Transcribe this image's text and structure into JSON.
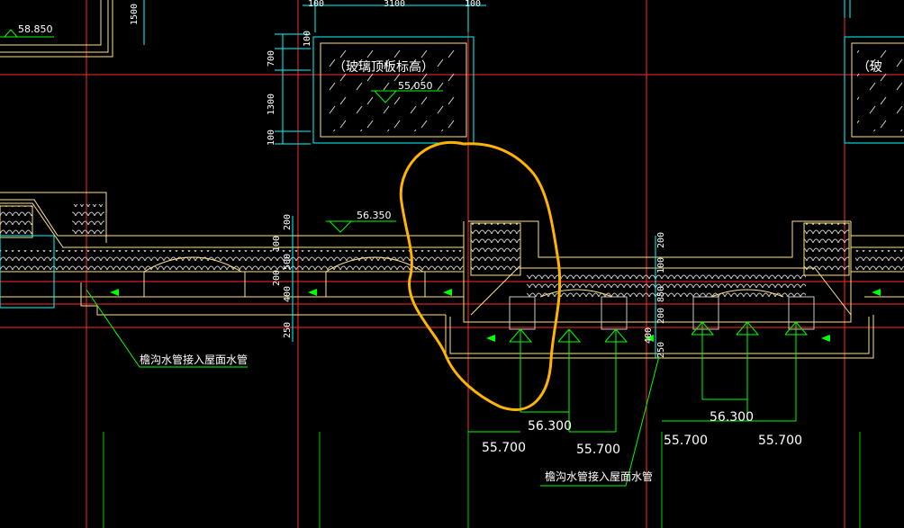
{
  "top_dims": {
    "d1": "100",
    "d2": "3100",
    "d3": "100"
  },
  "left_top": {
    "elevation": "58.850",
    "dim": "1500"
  },
  "glass_box_left": {
    "label": "（玻璃顶板标高）",
    "elevation": "55.050",
    "dims": [
      "100",
      "700",
      "1300",
      "100"
    ]
  },
  "glass_box_right": {
    "label": "（玻"
  },
  "center_elevation": "56.350",
  "mid_dims_left": [
    "200",
    "100",
    "500",
    "200",
    "400",
    "250"
  ],
  "mid_dims_right": [
    "200",
    "100",
    "850",
    "200",
    "400",
    "250"
  ],
  "gutter_note": "檐沟水管接入屋面水管",
  "elevations_bottom": {
    "e1": "56.300",
    "e2": "55.700",
    "e3": "55.700",
    "e4": "56.300",
    "e5": "55.700",
    "e6": "55.700"
  },
  "colors": {
    "background": "#000000",
    "outline": "#ffe28a",
    "cyan": "#00ffff",
    "red_axis": "#ff2a2a",
    "green": "#00ff00",
    "white": "#ffffff",
    "highlight": "#ffb400"
  }
}
